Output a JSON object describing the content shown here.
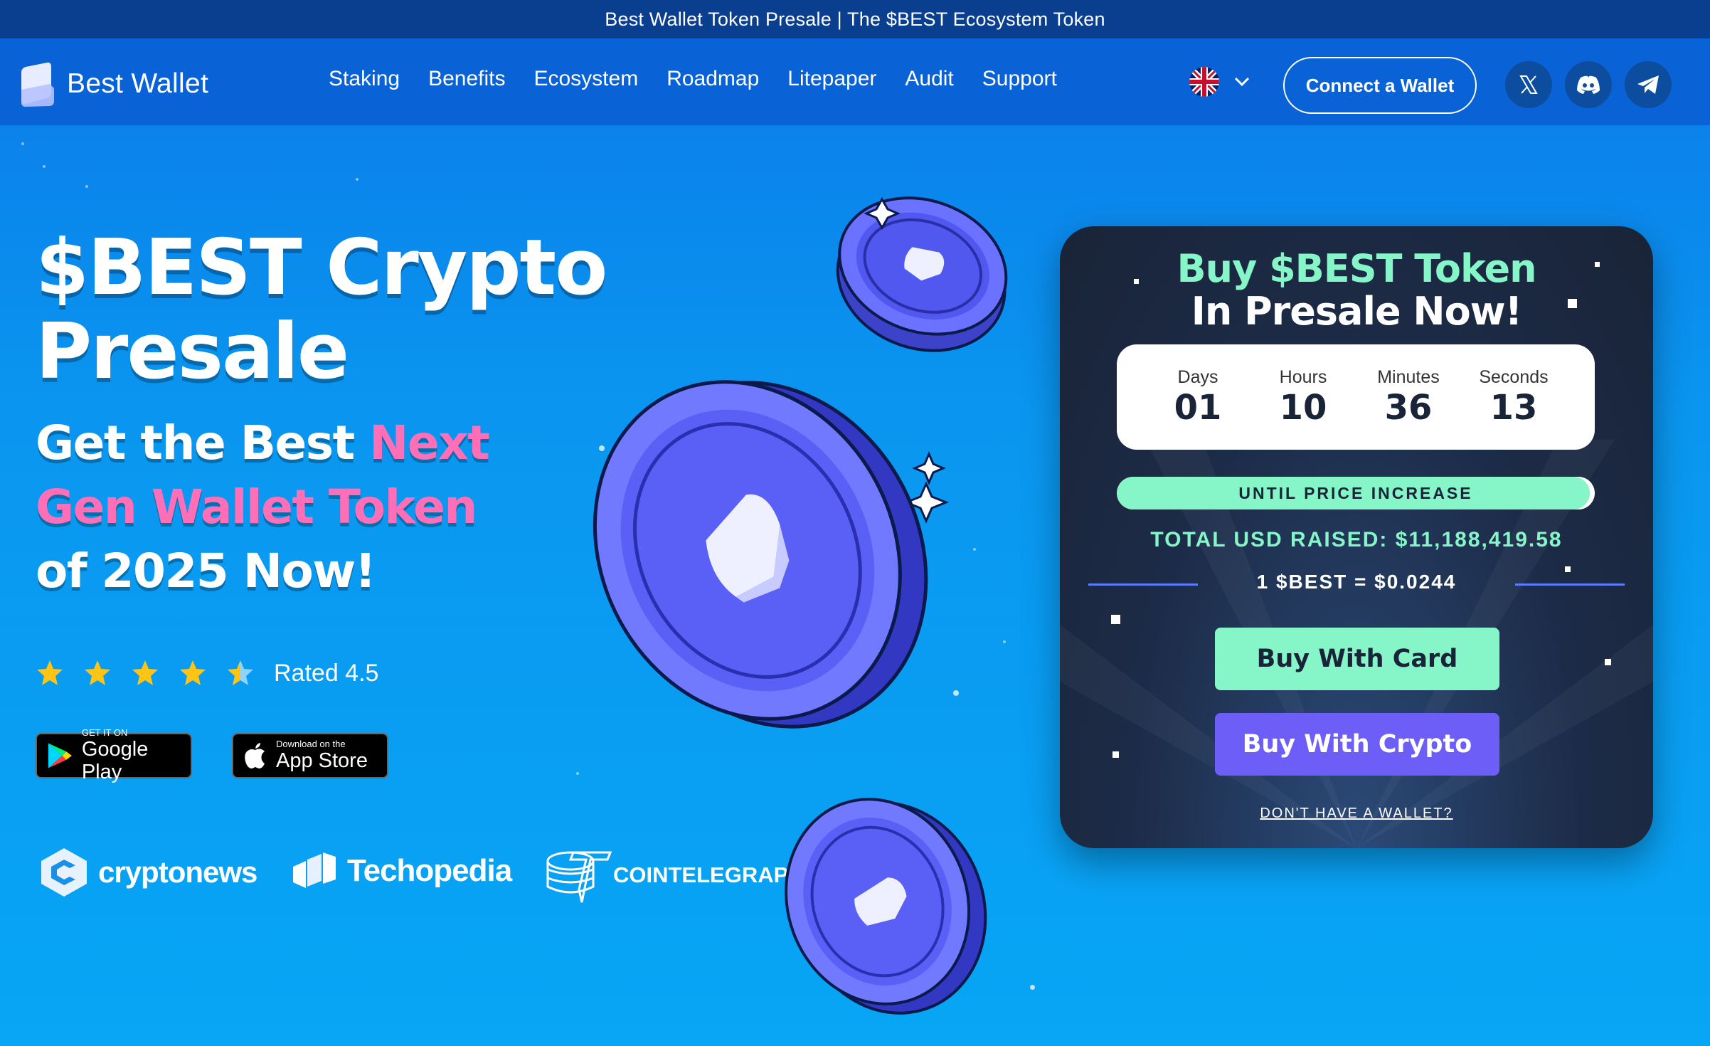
{
  "announcement": "Best Wallet Token Presale | The $BEST Ecosystem Token",
  "header": {
    "logo_text": "Best Wallet",
    "nav": [
      "Staking",
      "Benefits",
      "Ecosystem",
      "Roadmap",
      "Litepaper",
      "Audit",
      "Support"
    ],
    "language_icon": "uk-flag-icon",
    "connect_label": "Connect a Wallet",
    "socials": [
      "x-icon",
      "discord-icon",
      "telegram-icon"
    ]
  },
  "hero": {
    "title_line1": "$BEST Crypto",
    "title_line2": "Presale",
    "sub_part1": "Get the Best ",
    "sub_part2": "Next",
    "sub_part3": "Gen Wallet Token",
    "sub_part4": "of 2025 Now!",
    "rating": 4.5,
    "rated_label": "Rated 4.5",
    "google_small": "GET IT ON",
    "google_big": "Google Play",
    "apple_small": "Download on the",
    "apple_big": "App Store",
    "press": [
      "cryptonews",
      "Techopedia",
      "COINTELEGRAPH"
    ]
  },
  "card": {
    "title_line1": "Buy $BEST Token",
    "title_line2": "In Presale Now!",
    "timer": [
      {
        "label": "Days",
        "value": "01"
      },
      {
        "label": "Hours",
        "value": "10"
      },
      {
        "label": "Minutes",
        "value": "36"
      },
      {
        "label": "Seconds",
        "value": "13"
      }
    ],
    "progress_fraction": 0.99,
    "progress_label": "UNTIL PRICE INCREASE",
    "raised": "TOTAL USD RAISED: $11,188,419.58",
    "price": "1 $BEST = $0.0244",
    "buy_card": "Buy With Card",
    "buy_crypto": "Buy With Crypto",
    "no_wallet": "DON'T HAVE A WALLET?"
  },
  "colors": {
    "accent_green": "#86f5c7",
    "accent_purple": "#6d5ef7",
    "pink": "#ff6fb8",
    "header_blue": "#0962d6"
  }
}
